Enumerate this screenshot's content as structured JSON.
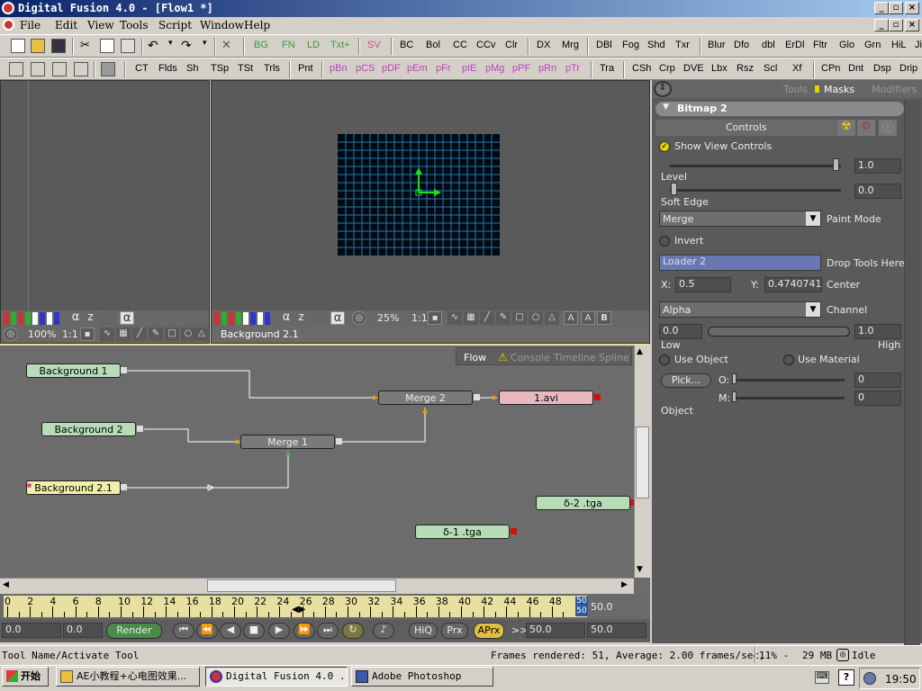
{
  "window": {
    "title": "Digital Fusion 4.0 - [Flow1 *]"
  },
  "menu": [
    "File",
    "Edit",
    "View",
    "Tools",
    "Script",
    "Window",
    "Help"
  ],
  "toolbar1": {
    "green": [
      "BG",
      "FN",
      "LD",
      "Txt+"
    ],
    "sv": "SV",
    "tools": [
      "BC",
      "Bol",
      "CC",
      "CCv",
      "Clr",
      "DX",
      "Mrg",
      "DBl",
      "Fog",
      "Shd",
      "Txr",
      "Blur",
      "Dfo",
      "dbl",
      "ErDl",
      "Fltr",
      "Glo",
      "Grn",
      "HiL",
      "Ji"
    ]
  },
  "toolbar2": {
    "tools_a": [
      "CT",
      "Flds",
      "Sh",
      "TSp",
      "TSt",
      "Trls",
      "Pnt"
    ],
    "pink": [
      "pBn",
      "pCS",
      "pDF",
      "pEm",
      "pFr",
      "pIE",
      "pMg",
      "pPF",
      "pRn",
      "pTr"
    ],
    "tools_b": [
      "Tra",
      "CSh",
      "Crp",
      "DVE",
      "Lbx",
      "Rsz",
      "Scl",
      "Xf",
      "CPn",
      "Dnt",
      "Dsp",
      "Drip"
    ]
  },
  "viewer_left": {
    "zoom": "100%",
    "ratio": "1:1",
    "alpha": "α",
    "z": "z"
  },
  "viewer_right": {
    "zoom": "25%",
    "ratio": "1:1",
    "caption": "Background 2.1",
    "alpha": "α",
    "z": "z"
  },
  "flow_tabs": [
    "Flow",
    "Console",
    "Timeline",
    "Spline"
  ],
  "nodes": {
    "bg1": "Background 1",
    "bg2": "Background 2",
    "bg21": "Background 2.1",
    "merge1": "Merge 1",
    "merge2": "Merge 2",
    "avi": "1.avi",
    "tga2": "δ-2 .tga",
    "tga1": "δ-1 .tga"
  },
  "timeline": {
    "ticks": [
      "0",
      "2",
      "4",
      "6",
      "8",
      "10",
      "12",
      "14",
      "16",
      "18",
      "20",
      "22",
      "24",
      "26",
      "28",
      "30",
      "32",
      "34",
      "36",
      "38",
      "40",
      "42",
      "44",
      "46",
      "48"
    ],
    "end_marker_top": "50",
    "end_marker_bottom": "50",
    "end_value": "50.0"
  },
  "transport": {
    "current": "0.0",
    "start": "0.0",
    "render": "Render",
    "hiq": "HiQ",
    "prx": "Prx",
    "aprx": "APrx",
    "arrows": ">>",
    "out": "50.0",
    "end": "50.0"
  },
  "props": {
    "tabs": [
      "Tools",
      "Masks",
      "Modifiers"
    ],
    "tool_name": "Bitmap 2",
    "controls": "Controls",
    "show_view_controls": "Show View Controls",
    "level_value": "1.0",
    "level_label": "Level",
    "soft_edge_value": "0.0",
    "soft_edge_label": "Soft Edge",
    "paint_mode_value": "Merge",
    "paint_mode_label": "Paint Mode",
    "invert": "Invert",
    "drop_value": "Loader 2",
    "drop_label": "Drop Tools Here",
    "x_label": "X:",
    "x_value": "0.5",
    "y_label": "Y:",
    "y_value": "0.4740741",
    "center_label": "Center",
    "channel_value": "Alpha",
    "channel_label": "Channel",
    "low_value": "0.0",
    "high_value": "1.0",
    "low_label": "Low",
    "high_label": "High",
    "use_object": "Use Object",
    "use_material": "Use Material",
    "pick": "Pick...",
    "o_label": "O:",
    "o_value": "0",
    "m_label": "M:",
    "m_value": "0",
    "object_label": "Object"
  },
  "status": {
    "left": "Tool Name/Activate Tool",
    "frames": "Frames rendered: 51,  Average: 2.00 frames/sec,",
    "percent": "11% -",
    "mem": "29 MB",
    "state": "Idle"
  },
  "taskbar": {
    "start": "开始",
    "task1": "AE小教程+心电图效果...",
    "task2": "Digital Fusion 4.0 ...",
    "task3": "Adobe Photoshop",
    "clock": "19:50"
  },
  "colors": {
    "node_green": "#b8dcb8",
    "node_gray": "#7a7a7a",
    "node_pink": "#e8b8c0",
    "node_yellow": "#f0f0a8",
    "grid_line": "#2a78b0",
    "titlebar": "#0a246a"
  }
}
